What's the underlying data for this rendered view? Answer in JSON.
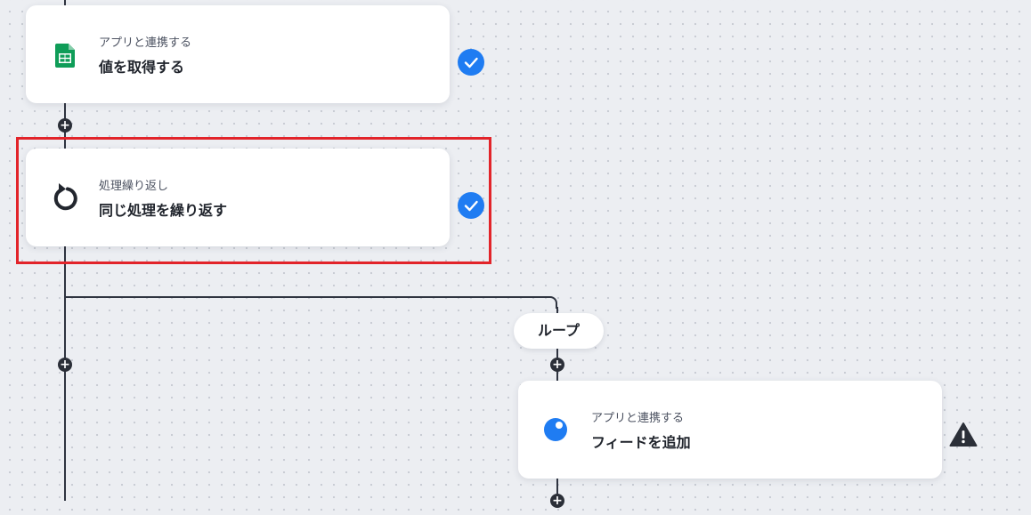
{
  "colors": {
    "accent": "#1f7cf2",
    "highlight": "#e2242a",
    "connector": "#2f3440",
    "sheets_green": "#0f9d58",
    "warning": "#2b2f38"
  },
  "nodes": [
    {
      "category": "アプリと連携する",
      "title": "値を取得する",
      "icon": "google-sheets-icon",
      "status": "check-icon"
    },
    {
      "category": "処理繰り返し",
      "title": "同じ処理を繰り返す",
      "icon": "repeat-icon",
      "status": "check-icon",
      "highlighted": true
    },
    {
      "category": "アプリと連携する",
      "title": "フィードを追加",
      "icon": "app-blue-circle-icon",
      "status": "warning-icon"
    }
  ],
  "loop": {
    "label": "ループ"
  }
}
